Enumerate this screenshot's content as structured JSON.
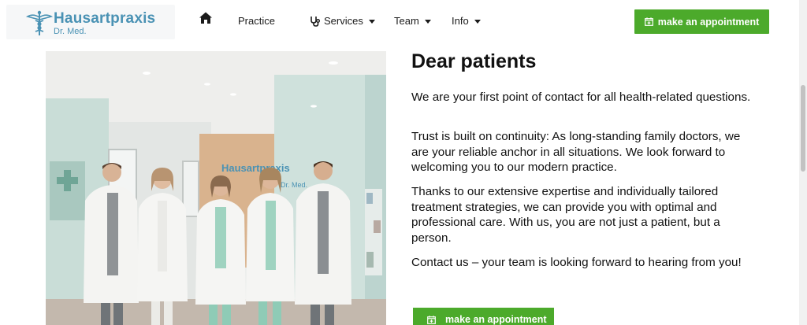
{
  "header": {
    "logo_title": "Hausartpraxis",
    "logo_subtitle": "Dr. Med.",
    "nav": [
      {
        "label": "Practice"
      },
      {
        "label": "Services"
      },
      {
        "label": "Team"
      },
      {
        "label": "Info"
      }
    ],
    "cta_label": "make an appointment"
  },
  "main": {
    "title": "Dear patients",
    "paragraphs": [
      "We are your first point of contact for all health-related questions.",
      "Trust is built on continuity: As long-standing family doctors, we are your reliable anchor in all situations. We look forward to welcoming you to our modern practice.",
      "Thanks to our extensive expertise and individually tailored treatment strategies, we can provide you with optimal and professional care. With us, you are not just a patient, but a person.",
      "Contact us – your team is looking forward to hearing from you!"
    ],
    "cta_label": "make an appointment",
    "photo": {
      "sign_title": "Hausartpraxis",
      "sign_subtitle": "Dr. Med."
    }
  },
  "colors": {
    "brand_blue": "#4a92b4",
    "cta_green": "#4caa2b"
  },
  "icons": [
    "caduceus-icon",
    "home-icon",
    "stethoscope-icon",
    "calendar-plus-icon"
  ]
}
